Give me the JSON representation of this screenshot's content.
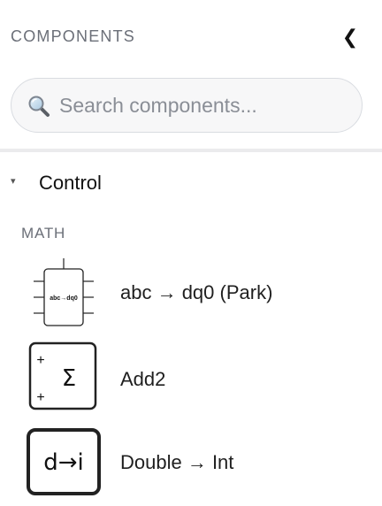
{
  "header": {
    "title": "COMPONENTS",
    "collapse_icon": "chevron-left-icon",
    "collapse_glyph": "❮"
  },
  "search": {
    "placeholder": "Search components...",
    "value": "",
    "icon": "search-icon"
  },
  "category": {
    "label": "Control",
    "expanded": true,
    "caret_glyph": "▾"
  },
  "section": {
    "label": "MATH"
  },
  "components": [
    {
      "name": "abc → dq0 (Park)",
      "icon": "abc-to-dq0-park-icon",
      "icon_text": "abc→dq0"
    },
    {
      "name": "Add2",
      "icon": "add2-sum-icon",
      "icon_symbol": "Σ",
      "icon_signs": [
        "+",
        "+"
      ]
    },
    {
      "name": "Double → Int",
      "icon": "double-to-int-icon",
      "icon_text": "d→i"
    }
  ],
  "colors": {
    "muted_text": "#6b6f78",
    "search_bg": "#f7f7f8",
    "search_border": "#d9dce1",
    "divider": "#ebebed"
  }
}
